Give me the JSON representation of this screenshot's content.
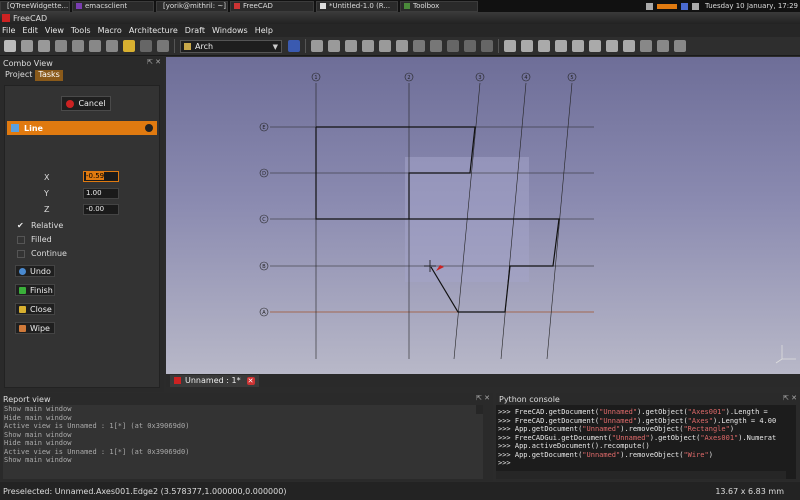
{
  "taskbar": {
    "items": [
      "[QTreeWidgette...",
      "emacsclient",
      "[yorik@mithril: ~]",
      "FreeCAD",
      "*Untitled-1.0 (R...",
      "Toolbox"
    ],
    "clock": "Tuesday 10 January, 17:29"
  },
  "window": {
    "title": "FreeCAD"
  },
  "menu": [
    "File",
    "Edit",
    "View",
    "Tools",
    "Macro",
    "Architecture",
    "Draft",
    "Windows",
    "Help"
  ],
  "toolbar": {
    "workbench": "Arch"
  },
  "combo_view": {
    "title": "Combo View",
    "tabs": [
      "Project",
      "Tasks"
    ],
    "active_tab": "Tasks",
    "cancel_label": "Cancel",
    "section_title": "Line",
    "x_label": "X",
    "x_value": "-0.59",
    "y_label": "Y",
    "y_value": "1.00",
    "z_label": "Z",
    "z_value": "-0.00",
    "checkboxes": [
      {
        "label": "Relative",
        "checked": true
      },
      {
        "label": "Filled",
        "checked": false
      },
      {
        "label": "Continue",
        "checked": false
      }
    ],
    "buttons": [
      "Undo",
      "Finish",
      "Close",
      "Wipe"
    ]
  },
  "viewport": {
    "axes_labels": [
      "1",
      "2",
      "3",
      "4",
      "5",
      "E",
      "D",
      "C",
      "B",
      "A"
    ]
  },
  "doc_tab": {
    "label": "Unnamed : 1*"
  },
  "report_view": {
    "title": "Report view",
    "lines": [
      "Show main window",
      "Hide main window",
      "Active view is Unnamed : 1[*] (at 0x39069d0)",
      "Show main window",
      "Hide main window",
      "Active view is Unnamed : 1[*] (at 0x39069d0)",
      "Show main window"
    ]
  },
  "python_console": {
    "title": "Python console",
    "lines": [
      [
        ">>> FreeCAD.getDocument(",
        "\"Unnamed\"",
        ").getObject(",
        "\"Axes001\"",
        ").Length = "
      ],
      [
        ">>> FreeCAD.getDocument(",
        "\"Unnamed\"",
        ").getObject(",
        "\"Axes\"",
        ").Length = 4.00"
      ],
      [
        ">>> App.getDocument(",
        "\"Unnamed\"",
        ").removeObject(",
        "\"Rectangle\"",
        ")"
      ],
      [
        ">>> FreeCADGui.getDocument(",
        "\"Unnamed\"",
        ").getObject(",
        "\"Axes001\"",
        ").Numerat"
      ],
      [
        ">>> App.activeDocument().recompute()",
        "",
        "",
        "",
        ""
      ],
      [
        ">>> App.getDocument(",
        "\"Unnamed\"",
        ").removeObject(",
        "\"Wire\"",
        ")"
      ],
      [
        ">>> ",
        "",
        "",
        "",
        ""
      ]
    ]
  },
  "status": {
    "message": "Preselected: Unnamed.Axes001.Edge2 (3.578377,1.000000,0.000000)",
    "dimensions": "13.67 x 6.83 mm"
  },
  "colors": {
    "accent": "#e07a10",
    "viewport_top": "#6e6e98",
    "viewport_bottom": "#b8b8c8"
  }
}
